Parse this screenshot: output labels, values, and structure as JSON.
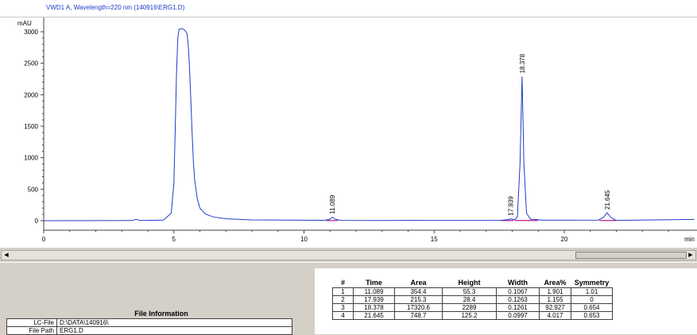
{
  "chart_data": {
    "type": "line",
    "title": "VWD1 A, Wavelength=220 nm (140916\\ERG1.D)",
    "ylabel": "mAU",
    "xlabel": "min",
    "xlim": [
      0,
      25
    ],
    "ylim": [
      0,
      3100
    ],
    "x_ticks": [
      0,
      5,
      10,
      15,
      20
    ],
    "y_ticks": [
      0,
      500,
      1000,
      1500,
      2000,
      2500,
      3000
    ],
    "grid": false,
    "series": [
      {
        "color": "#1c3cc8",
        "x": [
          0,
          3.4,
          3.55,
          3.7,
          4.6,
          4.9,
          5.0,
          5.05,
          5.1,
          5.15,
          5.2,
          5.3,
          5.4,
          5.5,
          5.55,
          5.6,
          5.65,
          5.7,
          5.75,
          5.8,
          5.9,
          6.0,
          6.2,
          6.5,
          7.0,
          8.0,
          10.8,
          11.0,
          11.09,
          11.2,
          11.4,
          13.0,
          17.6,
          17.8,
          17.94,
          18.1,
          18.2,
          18.3,
          18.378,
          18.45,
          18.55,
          18.7,
          19.2,
          21.3,
          21.5,
          21.645,
          21.8,
          22.0,
          25
        ],
        "y": [
          0,
          2,
          22,
          2,
          10,
          120,
          600,
          1400,
          2300,
          2900,
          3040,
          3050,
          3030,
          2980,
          2800,
          2450,
          1950,
          1400,
          950,
          650,
          350,
          200,
          110,
          60,
          30,
          12,
          6,
          25,
          55,
          25,
          5,
          4,
          6,
          15,
          28,
          15,
          60,
          900,
          2289,
          900,
          120,
          25,
          8,
          10,
          50,
          125,
          45,
          5,
          20
        ]
      }
    ],
    "peak_labels": [
      {
        "x": 11.089,
        "y": 55.3,
        "text": "11.089"
      },
      {
        "x": 17.939,
        "y": 28.4,
        "text": "17.939"
      },
      {
        "x": 18.378,
        "y": 2289,
        "text": "18.378"
      },
      {
        "x": 21.645,
        "y": 125.2,
        "text": "21.645"
      }
    ],
    "baseline_marks": [
      {
        "x1": 10.85,
        "x2": 11.3
      },
      {
        "x1": 17.55,
        "x2": 18.05
      },
      {
        "x1": 18.1,
        "x2": 19.0
      },
      {
        "x1": 21.35,
        "x2": 22.0
      }
    ],
    "baseline_color": "#c0148c"
  },
  "file_info": {
    "title": "File Information",
    "rows": [
      {
        "label": "LC-File",
        "value": "D:\\DATA\\140916\\"
      },
      {
        "label": "File Path",
        "value": "ERG1.D"
      }
    ]
  },
  "peak_table": {
    "headers": [
      "#",
      "Time",
      "Area",
      "Height",
      "Width",
      "Area%",
      "Symmetry"
    ],
    "rows": [
      [
        "1",
        "11.089",
        "354.4",
        "55.3",
        "0.1067",
        "1.901",
        "1.01"
      ],
      [
        "2",
        "17.939",
        "215.3",
        "28.4",
        "0.1263",
        "1.155",
        "0"
      ],
      [
        "3",
        "18.378",
        "17320.6",
        "2289",
        "0.1261",
        "92.927",
        "0.654"
      ],
      [
        "4",
        "21.645",
        "748.7",
        "125.2",
        "0.0997",
        "4.017",
        "0.653"
      ]
    ]
  },
  "scrollbar": {
    "left_icon": "arrow-left-icon",
    "right_icon": "arrow-right-icon"
  }
}
